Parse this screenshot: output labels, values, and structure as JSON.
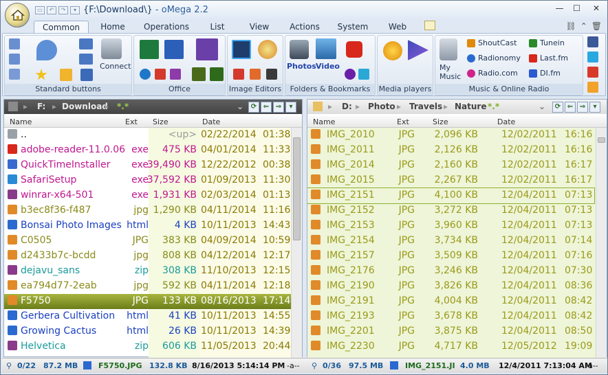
{
  "window": {
    "title": "{F:\\Download\\}",
    "app": " - oMega 2.2"
  },
  "tabs": [
    "Common",
    "Home",
    "Operations",
    "List",
    "View",
    "Actions",
    "System",
    "Web"
  ],
  "ribbon": {
    "groups": [
      "Standard buttons",
      "Office",
      "Image Editors",
      "Folders & Bookmarks",
      "Media players",
      "Music & Online Radio"
    ],
    "connect_label": "Connect",
    "photos_label": "Photos",
    "video_label": "Video",
    "mymusic_label": "My Music",
    "music_items": [
      "ShoutCast",
      "Tunein",
      "Radionomy",
      "Last.fm",
      "Radio.com",
      "DI.fm"
    ]
  },
  "left_panel": {
    "path": {
      "drive": "F:",
      "folder": "Download",
      "filter": "*.*"
    },
    "headers": [
      "Name",
      "Ext",
      "Size",
      "Date"
    ],
    "rows": [
      {
        "name": "..",
        "ext": "",
        "size": "<up>",
        "date": "02/22/2014",
        "time": "01:38",
        "color": "#222222",
        "icon": "up-icon"
      },
      {
        "name": "adobe-reader-11.0.06",
        "ext": "exe",
        "size": "475 KB",
        "date": "04/01/2014",
        "time": "11:33",
        "color": "#c0168f",
        "icon": "pdf-icon"
      },
      {
        "name": "QuickTimeInstaller",
        "ext": "exe",
        "size": "39,490 KB",
        "date": "12/22/2012",
        "time": "00:38",
        "color": "#c0168f",
        "icon": "quicktime-icon"
      },
      {
        "name": "SafariSetup",
        "ext": "exe",
        "size": "37,592 KB",
        "date": "01/09/2013",
        "time": "11:30",
        "color": "#c0168f",
        "icon": "safari-icon"
      },
      {
        "name": "winrar-x64-501",
        "ext": "exe",
        "size": "1,931 KB",
        "date": "02/03/2014",
        "time": "01:13",
        "color": "#c0168f",
        "icon": "winrar-icon"
      },
      {
        "name": "b3ec8f36-f487",
        "ext": "jpg",
        "size": "1,290 KB",
        "date": "04/11/2014",
        "time": "11:16",
        "color": "#8a8a1a",
        "icon": "image-icon"
      },
      {
        "name": "Bonsai Photo Images",
        "ext": "html",
        "size": "4 KB",
        "date": "10/11/2013",
        "time": "14:43",
        "color": "#1a3fbf",
        "icon": "html-icon"
      },
      {
        "name": "C0505",
        "ext": "JPG",
        "size": "383 KB",
        "date": "04/09/2014",
        "time": "10:59",
        "color": "#8a8a1a",
        "icon": "image-icon"
      },
      {
        "name": "d2433b7c-bcdd",
        "ext": "jpg",
        "size": "808 KB",
        "date": "04/12/2014",
        "time": "12:17",
        "color": "#8a8a1a",
        "icon": "image-icon"
      },
      {
        "name": "dejavu_sans",
        "ext": "zip",
        "size": "308 KB",
        "date": "11/10/2013",
        "time": "12:15",
        "color": "#1a9a9a",
        "icon": "archive-icon"
      },
      {
        "name": "ea794d77-2eab",
        "ext": "jpg",
        "size": "592 KB",
        "date": "04/11/2014",
        "time": "12:18",
        "color": "#8a8a1a",
        "icon": "image-icon"
      },
      {
        "name": "F5750",
        "ext": "JPG",
        "size": "133 KB",
        "date": "08/16/2013",
        "time": "17:14",
        "color": "#ffffff",
        "icon": "image-icon",
        "selected": true
      },
      {
        "name": "Gerbera Cultivation",
        "ext": "html",
        "size": "41 KB",
        "date": "10/11/2013",
        "time": "14:55",
        "color": "#1a3fbf",
        "icon": "html-icon"
      },
      {
        "name": "Growing Cactus",
        "ext": "html",
        "size": "26 KB",
        "date": "10/11/2013",
        "time": "14:39",
        "color": "#1a3fbf",
        "icon": "html-icon"
      },
      {
        "name": "Helvetica",
        "ext": "zip",
        "size": "606 KB",
        "date": "11/05/2013",
        "time": "20:44",
        "color": "#1a9a9a",
        "icon": "archive-icon"
      }
    ]
  },
  "right_panel": {
    "path": {
      "drive": "D:",
      "crumbs": [
        "Photo",
        "Travels",
        "Nature"
      ],
      "filter": "*.*"
    },
    "headers": [
      "Name",
      "Ext",
      "Size",
      "Date"
    ],
    "rows": [
      {
        "name": "IMG_2010",
        "ext": "JPG",
        "size": "2,096 KB",
        "date": "12/02/2011",
        "time": "16:16"
      },
      {
        "name": "IMG_2011",
        "ext": "JPG",
        "size": "2,126 KB",
        "date": "12/02/2011",
        "time": "16:16"
      },
      {
        "name": "IMG_2014",
        "ext": "JPG",
        "size": "2,160 KB",
        "date": "12/02/2011",
        "time": "16:17"
      },
      {
        "name": "IMG_2015",
        "ext": "JPG",
        "size": "2,267 KB",
        "date": "12/02/2011",
        "time": "16:17"
      },
      {
        "name": "IMG_2151",
        "ext": "JPG",
        "size": "4,100 KB",
        "date": "12/04/2011",
        "time": "07:13",
        "focused": true
      },
      {
        "name": "IMG_2152",
        "ext": "JPG",
        "size": "3,272 KB",
        "date": "12/04/2011",
        "time": "07:13"
      },
      {
        "name": "IMG_2153",
        "ext": "JPG",
        "size": "3,960 KB",
        "date": "12/04/2011",
        "time": "07:13"
      },
      {
        "name": "IMG_2154",
        "ext": "JPG",
        "size": "3,734 KB",
        "date": "12/04/2011",
        "time": "07:14"
      },
      {
        "name": "IMG_2157",
        "ext": "JPG",
        "size": "3,509 KB",
        "date": "12/04/2011",
        "time": "07:16"
      },
      {
        "name": "IMG_2176",
        "ext": "JPG",
        "size": "3,246 KB",
        "date": "12/04/2011",
        "time": "07:30"
      },
      {
        "name": "IMG_2190",
        "ext": "JPG",
        "size": "3,826 KB",
        "date": "12/04/2011",
        "time": "08:36"
      },
      {
        "name": "IMG_2191",
        "ext": "JPG",
        "size": "4,004 KB",
        "date": "12/04/2011",
        "time": "08:42"
      },
      {
        "name": "IMG_2193",
        "ext": "JPG",
        "size": "3,678 KB",
        "date": "12/04/2011",
        "time": "08:42"
      },
      {
        "name": "IMG_2201",
        "ext": "JPG",
        "size": "3,875 KB",
        "date": "12/04/2011",
        "time": "08:50"
      },
      {
        "name": "IMG_2230",
        "ext": "JPG",
        "size": "4,717 KB",
        "date": "12/05/2012",
        "time": "19:09"
      }
    ]
  },
  "status_left": {
    "count": "0/22",
    "total": "87.2 MB",
    "file": "F5750.JPG",
    "size": "132.8 KB",
    "datetime": "8/16/2013 5:14:14 PM",
    "attr": "-a--"
  },
  "status_right": {
    "count": "0/36",
    "total": "97.5 MB",
    "file": "IMG_2151.JI",
    "size": "4.0 MB",
    "datetime": "12/4/2011 7:13:04 AM",
    "attr": "-a--"
  },
  "colors": {
    "selected_row": "#7d8f22",
    "image_files": "#8a8a1a",
    "exe_files": "#c0168f",
    "html_files": "#1a3fbf",
    "zip_files": "#1a9a9a",
    "right_rows": "#9a9a1a",
    "right_bg": "#eef5d8"
  }
}
